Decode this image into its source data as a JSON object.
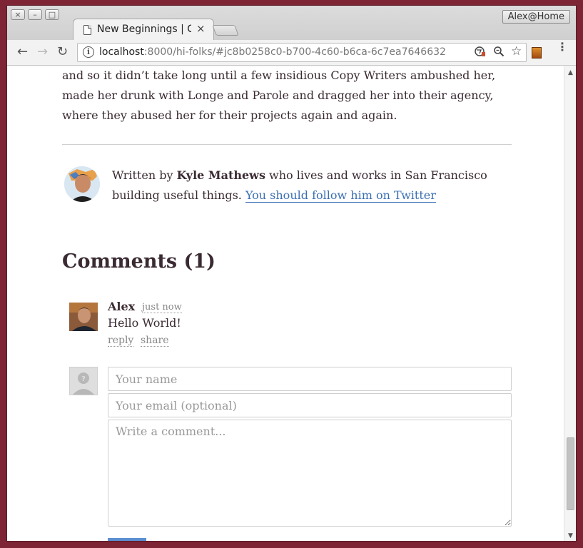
{
  "window": {
    "controls": [
      "×",
      "–",
      "□"
    ],
    "profile_label": "Alex@Home"
  },
  "tab": {
    "title": "New Beginnings | C",
    "close": "×"
  },
  "toolbar": {
    "back": "←",
    "forward": "→",
    "reload": "↻",
    "url_host": "localhost",
    "url_rest": ":8000/hi-folks/#jc8b0258c0-b700-4c60-b6ca-6c7ea7646632",
    "zoom_icon": "🔍",
    "star_icon": "☆",
    "menu_icon": "⋮"
  },
  "article": {
    "paragraph_lines": [
      "and so it didn’t take long until a few insidious Copy Writers ambushed her,",
      "made her drunk with Longe and Parole and dragged her into their agency,",
      "where they abused her for their projects again and again."
    ]
  },
  "author": {
    "prefix": "Written by ",
    "name": "Kyle Mathews",
    "middle": " who lives and works in San Francisco building useful things. ",
    "link_text": "You should follow him on Twitter"
  },
  "comments": {
    "heading": "Comments (1)",
    "items": [
      {
        "author": "Alex",
        "time": "just now",
        "text": "Hello World!",
        "reply": "reply",
        "share": "share"
      }
    ]
  },
  "form": {
    "name_placeholder": "Your name",
    "email_placeholder": "Your email (optional)",
    "comment_placeholder": "Write a comment..."
  },
  "colors": {
    "link": "#3b6fb3",
    "text": "#3a2a32",
    "desktop": "#7d2535",
    "submit": "#5b8fd1"
  }
}
